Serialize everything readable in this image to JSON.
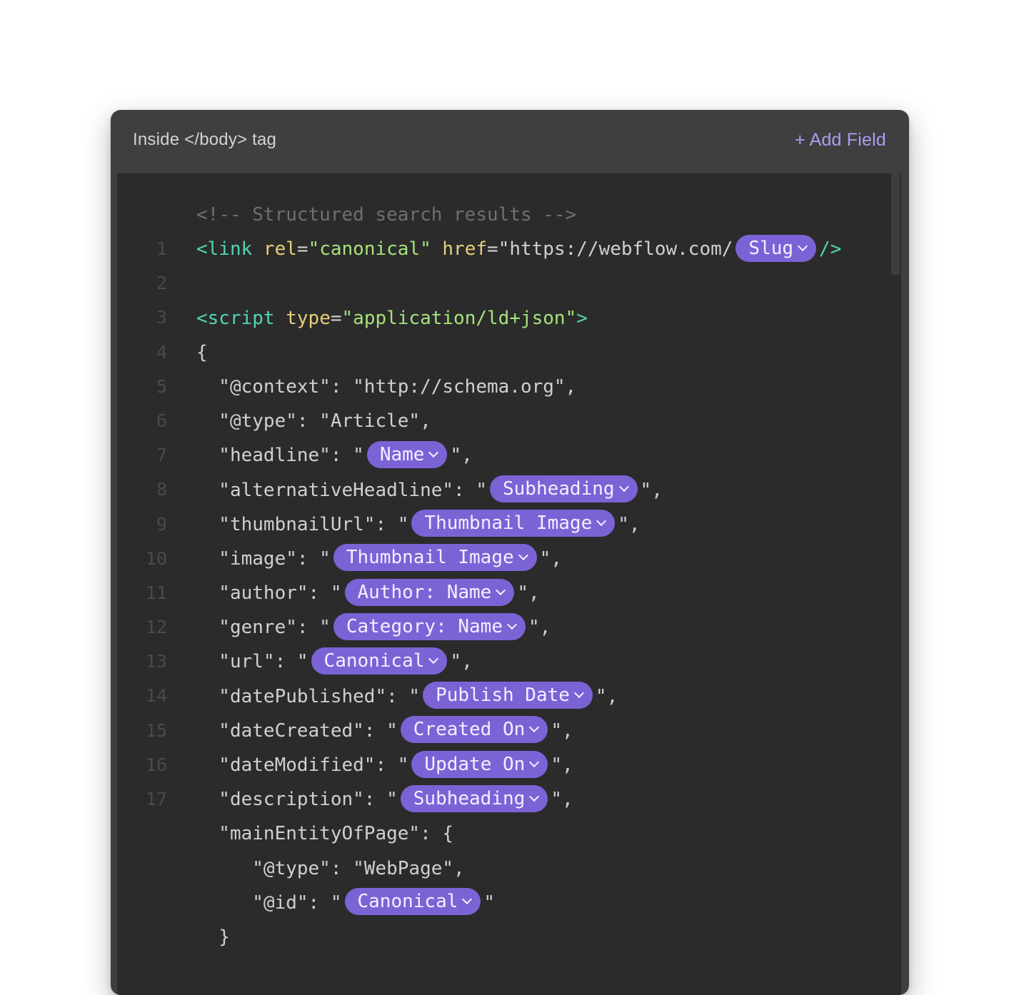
{
  "header": {
    "title": "Inside </body> tag",
    "add_field_label": "+ Add Field"
  },
  "editor": {
    "line_numbers": [
      "1",
      "2",
      "3",
      "4",
      "5",
      "6",
      "7",
      "8",
      "9",
      "10",
      "11",
      "12",
      "13",
      "14",
      "15",
      "16",
      "17"
    ],
    "comment": "<!-- Structured search results -->",
    "link_tag_open": "<link",
    "rel_attr": " rel",
    "eq": "=",
    "rel_value": "\"canonical\"",
    "href_attr": " href",
    "href_value_start": "\"https://webflow.com/",
    "link_close": "/>",
    "script_tag_open": "<script",
    "type_attr": " type",
    "type_value": "\"application/ld+json\"",
    "script_tag_end": ">",
    "brace_open": "{",
    "brace_close": "}",
    "context_line": "  \"@context\": \"http://schema.org\",",
    "type_line": "  \"@type\": \"Article\",",
    "keys": {
      "headline": "  \"headline\": \"",
      "alternativeHeadline": "  \"alternativeHeadline\": \"",
      "thumbnailUrl": "  \"thumbnailUrl\": \"",
      "image": "  \"image\": \"",
      "author": "  \"author\": \"",
      "genre": "  \"genre\": \"",
      "url": "  \"url\": \"",
      "datePublished": "  \"datePublished\": \"",
      "dateCreated": "  \"dateCreated\": \"",
      "dateModified": "  \"dateModified\": \"",
      "description": "  \"description\": \"",
      "mainEntityOfPage": "  \"mainEntityOfPage\": {",
      "webpage_type": "     \"@type\": \"WebPage\",",
      "id": "     \"@id\": \""
    },
    "suffix_comma": "\",",
    "suffix_quote": "\"",
    "closing_brace_indent": "  }",
    "pills": {
      "slug": "Slug",
      "headline": "Name",
      "alternativeHeadline": "Subheading",
      "thumbnailUrl": "Thumbnail Image",
      "image": "Thumbnail Image",
      "author": "Author: Name",
      "genre": "Category: Name",
      "url": "Canonical",
      "datePublished": "Publish Date",
      "dateCreated": "Created On",
      "dateModified": "Update On",
      "description": "Subheading",
      "id": "Canonical"
    }
  },
  "colors": {
    "panel_bg": "#3f3f3f",
    "editor_bg": "#2b2b2b",
    "accent": "#a99ef3",
    "pill": "#7b63d6",
    "tag": "#4fd6b6",
    "attr": "#e6cf7a",
    "string": "#a6e27a",
    "comment": "#6f6f6f"
  }
}
